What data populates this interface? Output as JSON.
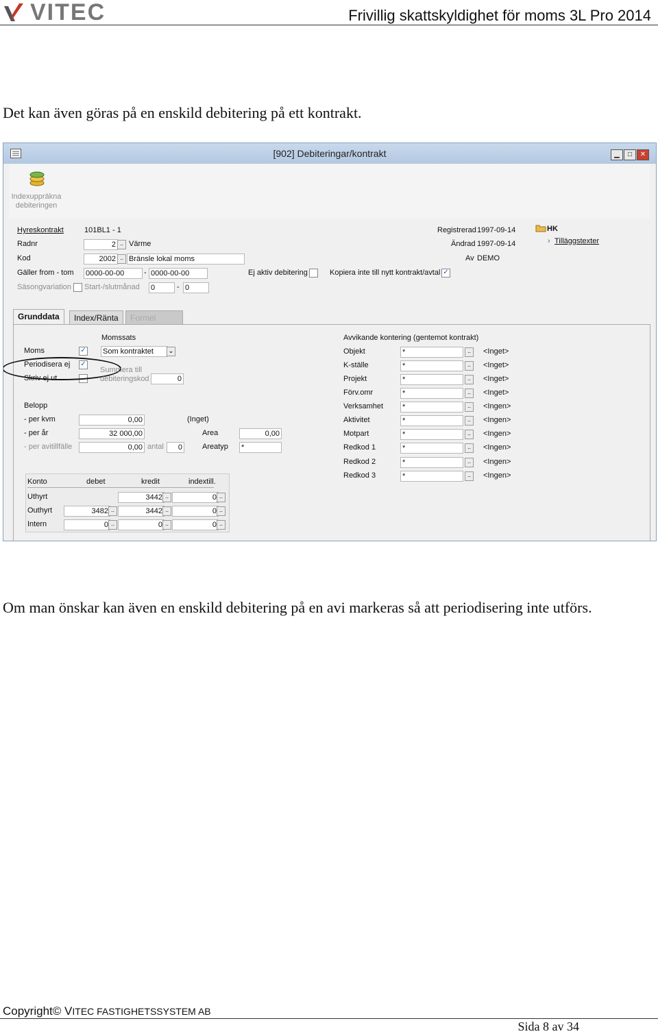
{
  "header": {
    "logo_text": "VITEC",
    "doc_title": "Frivillig skattskyldighet för moms 3L Pro 2014"
  },
  "intro_text": "Det kan även göras på en enskild debitering på ett kontrakt.",
  "window": {
    "title": "[902]  Debiteringar/kontrakt",
    "toolbar_button": "Indexuppräkna debiteringen",
    "top_fields": {
      "hyreskontrakt_label": "Hyreskontrakt",
      "hyreskontrakt_value": "101BL1 - 1",
      "radnr_label": "Radnr",
      "radnr_value": "2",
      "radnr_text": "Värme",
      "kod_label": "Kod",
      "kod_value": "2002",
      "kod_text": "Bränsle lokal moms",
      "galler_label": "Gäller from - tom",
      "galler_from": "0000-00-00",
      "galler_tom": "0000-00-00",
      "dash": "-",
      "sasong_label": "Säsongvariation",
      "startslut_label": "Start-/slutmånad",
      "start_value": "0",
      "slut_value": "0",
      "ej_aktiv_label": "Ej aktiv debitering",
      "kopiera_label": "Kopiera inte till nytt kontrakt/avtal",
      "registrerad_label": "Registrerad",
      "registrerad_value": "1997-09-14",
      "andrad_label": "Ändrad",
      "andrad_value": "1997-09-14",
      "av_label": "Av",
      "av_value": "DEMO",
      "hk_label": "HK",
      "tillagg_label": "Tilläggstexter"
    },
    "tabs": [
      "Grunddata",
      "Index/Ränta",
      "Formel"
    ],
    "grunddata": {
      "moms_label": "Moms",
      "periodisera_label": "Periodisera ej",
      "skriv_label": "Skriv ej ut",
      "momssats_label": "Momssats",
      "momssats_value": "Som kontraktet",
      "summera_label_1": "Summera till",
      "summera_label_2": "debiteringskod",
      "summera_value": "0",
      "belopp_label": "Belopp",
      "per_kvm_label": "- per kvm",
      "per_kvm_value": "0,00",
      "inget_label": "(Inget)",
      "per_ar_label": "- per år",
      "per_ar_value": "32 000,00",
      "area_label": "Area",
      "area_value": "0,00",
      "avitill_label": "- per avitillfälle",
      "avitill_value": "0,00",
      "antal_label": "antal",
      "antal_value": "0",
      "areatyp_label": "Areatyp",
      "areatyp_value": "*"
    },
    "konto": {
      "headers": [
        "Konto",
        "debet",
        "kredit",
        "indextill."
      ],
      "rows": [
        {
          "label": "Uthyrt",
          "debet": "",
          "kredit": "3442",
          "index": "0"
        },
        {
          "label": "Outhyrt",
          "debet": "3482",
          "kredit": "3442",
          "index": "0"
        },
        {
          "label": "Intern",
          "debet": "0",
          "kredit": "0",
          "index": "0"
        }
      ]
    },
    "avvikande": {
      "title": "Avvikande kontering (gentemot kontrakt)",
      "rows": [
        {
          "label": "Objekt",
          "value": "*",
          "desc": "<Inget>"
        },
        {
          "label": "K-ställe",
          "value": "*",
          "desc": "<Inget>"
        },
        {
          "label": "Projekt",
          "value": "*",
          "desc": "<Inget>"
        },
        {
          "label": "Förv.omr",
          "value": "*",
          "desc": "<Inget>"
        },
        {
          "label": "Verksamhet",
          "value": "*",
          "desc": "<Ingen>"
        },
        {
          "label": "Aktivitet",
          "value": "*",
          "desc": "<Ingen>"
        },
        {
          "label": "Motpart",
          "value": "*",
          "desc": "<Ingen>"
        },
        {
          "label": "Redkod 1",
          "value": "*",
          "desc": "<Ingen>"
        },
        {
          "label": "Redkod 2",
          "value": "*",
          "desc": "<Ingen>"
        },
        {
          "label": "Redkod 3",
          "value": "*",
          "desc": "<Ingen>"
        }
      ]
    }
  },
  "body_text": "Om man önskar kan även en enskild debitering på en avi markeras så att periodisering inte utförs.",
  "footer": {
    "copyright": "Copyright©",
    "company_first": "V",
    "company_rest": "ITEC FASTIGHETSSYSTEM AB",
    "page": "Sida 8 av 34"
  }
}
